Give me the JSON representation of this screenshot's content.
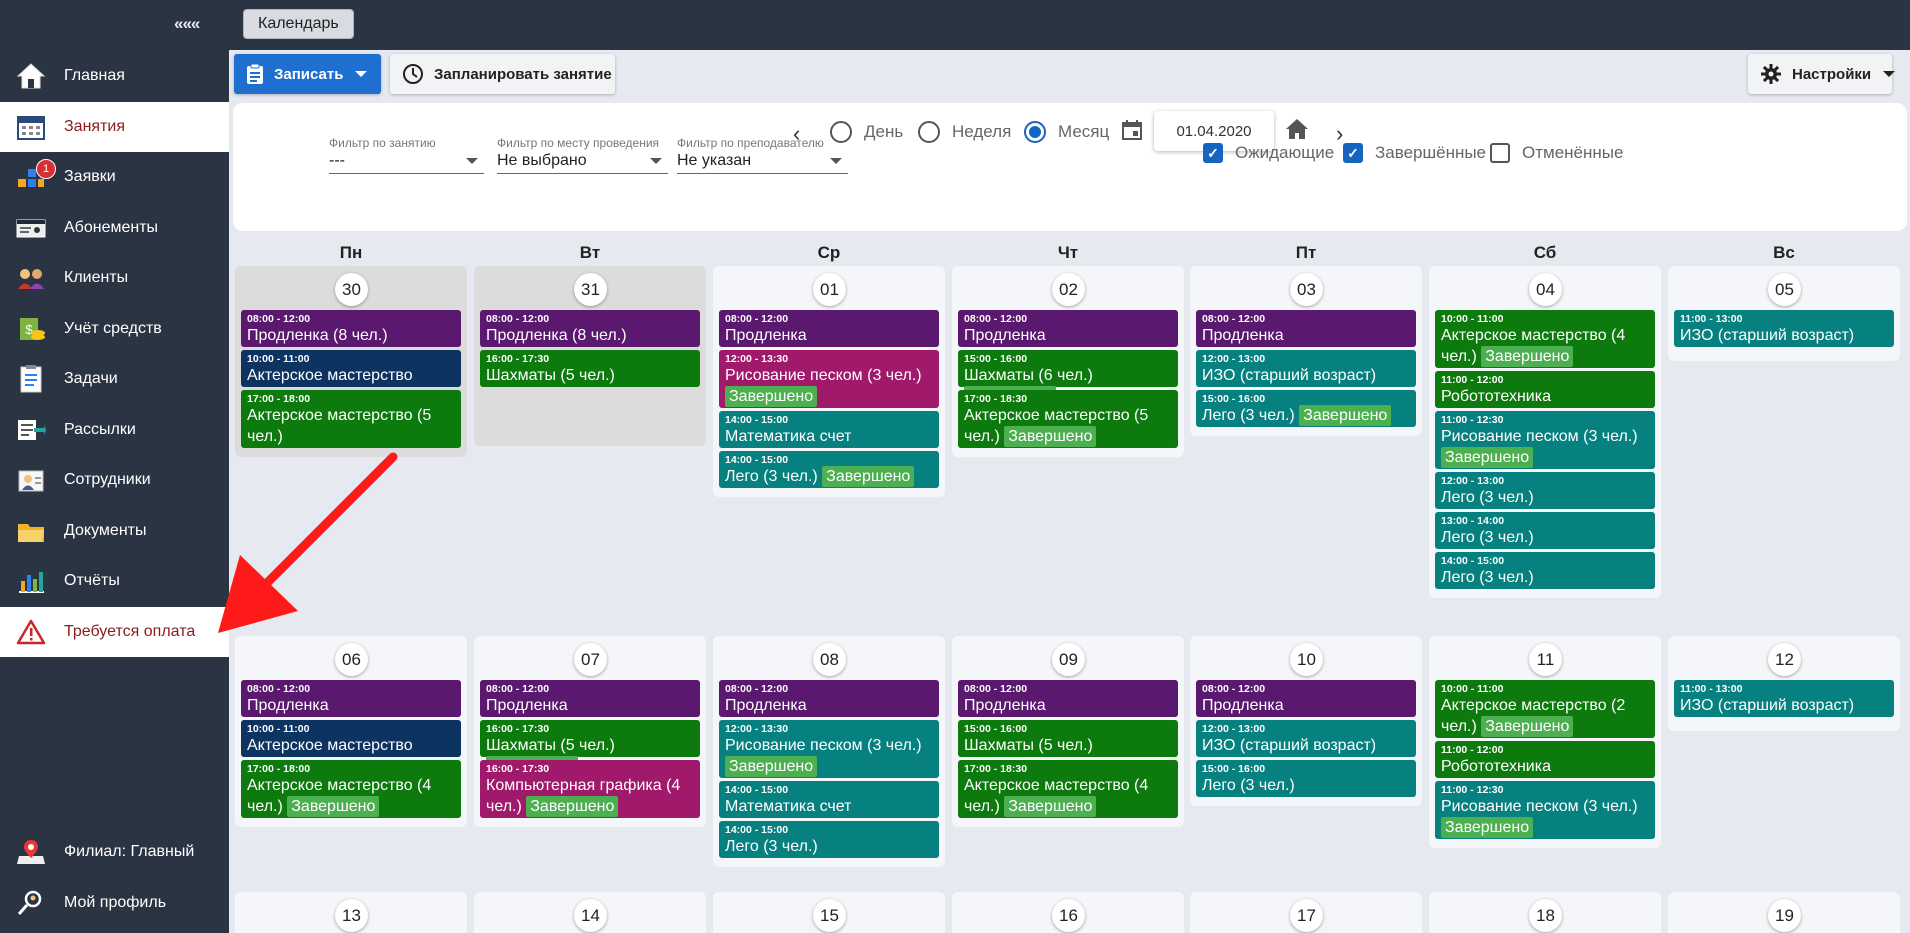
{
  "sidebar": {
    "collapse_label": "«««",
    "items": [
      {
        "label": "Главная",
        "icon": "house-icon"
      },
      {
        "label": "Занятия",
        "icon": "calendar-icon"
      },
      {
        "label": "Заявки",
        "icon": "requests-icon",
        "badge": "1"
      },
      {
        "label": "Абонементы",
        "icon": "subscription-card-icon"
      },
      {
        "label": "Клиенты",
        "icon": "clients-icon"
      },
      {
        "label": "Учёт средств",
        "icon": "money-icon"
      },
      {
        "label": "Задачи",
        "icon": "tasks-icon"
      },
      {
        "label": "Рассылки",
        "icon": "mailing-icon"
      },
      {
        "label": "Сотрудники",
        "icon": "staff-icon"
      },
      {
        "label": "Документы",
        "icon": "folder-icon"
      },
      {
        "label": "Отчёты",
        "icon": "chart-icon"
      },
      {
        "label": "Требуется оплата",
        "icon": "warning-icon"
      }
    ],
    "branch_label": "Филиал: Главный",
    "profile_label": "Мой профиль"
  },
  "topbar": {
    "tab_label": "Календарь"
  },
  "toolbar": {
    "record_label": "Записать",
    "schedule_label": "Запланировать занятие",
    "settings_label": "Настройки"
  },
  "view": {
    "day_label": "День",
    "week_label": "Неделя",
    "month_label": "Месяц",
    "selected": "Месяц",
    "date": "01.04.2020"
  },
  "filters": {
    "lesson": {
      "label": "Фильтр по занятию",
      "value": "---"
    },
    "place": {
      "label": "Фильтр по месту проведения",
      "value": "Не выбрано"
    },
    "teacher": {
      "label": "Фильтр по преподавателю",
      "value": "Не указан"
    }
  },
  "status_checks": [
    {
      "label": "Ожидающие",
      "checked": true
    },
    {
      "label": "Завершённые",
      "checked": true
    },
    {
      "label": "Отменённые",
      "checked": false
    }
  ],
  "weekdays": [
    "Пн",
    "Вт",
    "Ср",
    "Чт",
    "Пт",
    "Сб",
    "Вс"
  ],
  "done_label": "Завершено",
  "colors": {
    "purple": "#5a186f",
    "navy": "#0d3360",
    "green": "#0c7a0c",
    "magenta": "#a0196a",
    "teal": "#078180",
    "done": "#4caf50",
    "primary": "#1f6fd1",
    "sidebar": "#2a3443"
  },
  "week1": [
    {
      "day": "30",
      "out": true,
      "events": [
        {
          "time": "08:00 - 12:00",
          "name": "Продленка (8 чел.)",
          "color": "purple"
        },
        {
          "time": "10:00 - 11:00",
          "name": "Актерское мастерство",
          "color": "navy"
        },
        {
          "time": "17:00 - 18:00",
          "name": "Актерское мастерство (5 чел.)",
          "color": "green"
        }
      ]
    },
    {
      "day": "31",
      "out": true,
      "events": [
        {
          "time": "08:00 - 12:00",
          "name": "Продленка (8 чел.)",
          "color": "purple"
        },
        {
          "time": "16:00 - 17:30",
          "name": "Шахматы (5 чел.)",
          "color": "green"
        }
      ]
    },
    {
      "day": "01",
      "events": [
        {
          "time": "08:00 - 12:00",
          "name": "Продленка",
          "color": "purple"
        },
        {
          "time": "12:00 - 13:30",
          "name": "Рисование песком (3 чел.)",
          "color": "magenta",
          "done": true
        },
        {
          "time": "14:00 - 15:00",
          "name": "Математика счет",
          "color": "teal"
        },
        {
          "time": "14:00 - 15:00",
          "name": "Лего (3 чел.)",
          "color": "teal",
          "done": true
        }
      ]
    },
    {
      "day": "02",
      "events": [
        {
          "time": "08:00 - 12:00",
          "name": "Продленка",
          "color": "purple"
        },
        {
          "time": "15:00 - 16:00",
          "name": "Шахматы (6 чел.)",
          "color": "green",
          "done": true
        },
        {
          "time": "17:00 - 18:30",
          "name": "Актерское мастерство (5 чел.)",
          "color": "green",
          "done": true
        }
      ]
    },
    {
      "day": "03",
      "events": [
        {
          "time": "08:00 - 12:00",
          "name": "Продленка",
          "color": "purple"
        },
        {
          "time": "12:00 - 13:00",
          "name": "ИЗО (старший возраст)",
          "color": "teal"
        },
        {
          "time": "15:00 - 16:00",
          "name": "Лего (3 чел.)",
          "color": "teal",
          "done": true
        }
      ]
    },
    {
      "day": "04",
      "events": [
        {
          "time": "10:00 - 11:00",
          "name": "Актерское мастерство (4 чел.)",
          "color": "green",
          "done": true
        },
        {
          "time": "11:00 - 12:00",
          "name": "Робототехника",
          "color": "green"
        },
        {
          "time": "11:00 - 12:30",
          "name": "Рисование песком (3 чел.)",
          "color": "teal",
          "done": true
        },
        {
          "time": "12:00 - 13:00",
          "name": "Лего (3 чел.)",
          "color": "teal"
        },
        {
          "time": "13:00 - 14:00",
          "name": "Лего (3 чел.)",
          "color": "teal"
        },
        {
          "time": "14:00 - 15:00",
          "name": "Лего (3 чел.)",
          "color": "teal"
        }
      ]
    },
    {
      "day": "05",
      "events": [
        {
          "time": "11:00 - 13:00",
          "name": "ИЗО (старший возраст)",
          "color": "teal"
        }
      ]
    }
  ],
  "week2": [
    {
      "day": "06",
      "events": [
        {
          "time": "08:00 - 12:00",
          "name": "Продленка",
          "color": "purple"
        },
        {
          "time": "10:00 - 11:00",
          "name": "Актерское мастерство",
          "color": "navy"
        },
        {
          "time": "17:00 - 18:00",
          "name": "Актерское мастерство (4 чел.)",
          "color": "green",
          "done": true
        }
      ]
    },
    {
      "day": "07",
      "events": [
        {
          "time": "08:00 - 12:00",
          "name": "Продленка",
          "color": "purple"
        },
        {
          "time": "16:00 - 17:30",
          "name": "Шахматы (5 чел.)",
          "color": "green",
          "done": true
        },
        {
          "time": "16:00 - 17:30",
          "name": "Компьютерная графика (4 чел.)",
          "color": "magenta",
          "done": true
        }
      ]
    },
    {
      "day": "08",
      "events": [
        {
          "time": "08:00 - 12:00",
          "name": "Продленка",
          "color": "purple"
        },
        {
          "time": "12:00 - 13:30",
          "name": "Рисование песком (3 чел.)",
          "color": "teal",
          "done": true
        },
        {
          "time": "14:00 - 15:00",
          "name": "Математика счет",
          "color": "teal"
        },
        {
          "time": "14:00 - 15:00",
          "name": "Лего (3 чел.)",
          "color": "teal"
        }
      ]
    },
    {
      "day": "09",
      "events": [
        {
          "time": "08:00 - 12:00",
          "name": "Продленка",
          "color": "purple"
        },
        {
          "time": "15:00 - 16:00",
          "name": "Шахматы (5 чел.)",
          "color": "green"
        },
        {
          "time": "17:00 - 18:30",
          "name": "Актерское мастерство (4 чел.)",
          "color": "green",
          "done": true
        }
      ]
    },
    {
      "day": "10",
      "events": [
        {
          "time": "08:00 - 12:00",
          "name": "Продленка",
          "color": "purple"
        },
        {
          "time": "12:00 - 13:00",
          "name": "ИЗО (старший возраст)",
          "color": "teal"
        },
        {
          "time": "15:00 - 16:00",
          "name": "Лего (3 чел.)",
          "color": "teal"
        }
      ]
    },
    {
      "day": "11",
      "events": [
        {
          "time": "10:00 - 11:00",
          "name": "Актерское мастерство (2 чел.)",
          "color": "green",
          "done": true
        },
        {
          "time": "11:00 - 12:00",
          "name": "Робототехника",
          "color": "green"
        },
        {
          "time": "11:00 - 12:30",
          "name": "Рисование песком (3 чел.)",
          "color": "teal",
          "done": true
        }
      ]
    },
    {
      "day": "12",
      "events": [
        {
          "time": "11:00 - 13:00",
          "name": "ИЗО (старший возраст)",
          "color": "teal"
        }
      ]
    }
  ],
  "week3": [
    {
      "day": "13"
    },
    {
      "day": "14"
    },
    {
      "day": "15"
    },
    {
      "day": "16"
    },
    {
      "day": "17"
    },
    {
      "day": "18"
    },
    {
      "day": "19"
    }
  ]
}
